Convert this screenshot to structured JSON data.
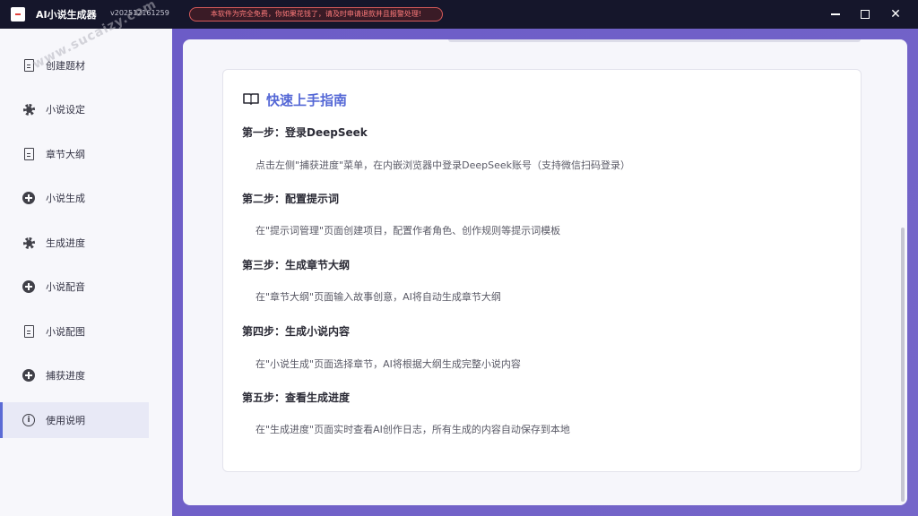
{
  "titlebar": {
    "app_title": "AI小说生成器",
    "version": "v202512161259",
    "warning": "本软件为完全免费，你如果花钱了，请及时申请退款并且报警处理!",
    "minimize_icon": "minimize-icon",
    "maximize_icon": "maximize-icon",
    "close_icon": "close-icon",
    "close_glyph": "✕"
  },
  "watermark": "www.sucaizy.com",
  "sidebar": {
    "items": [
      {
        "label": "创建题材",
        "icon": "document-icon"
      },
      {
        "label": "小说设定",
        "icon": "gear-icon"
      },
      {
        "label": "章节大纲",
        "icon": "document-icon"
      },
      {
        "label": "小说生成",
        "icon": "plus-circle-icon"
      },
      {
        "label": "生成进度",
        "icon": "gear-icon"
      },
      {
        "label": "小说配音",
        "icon": "plus-circle-icon"
      },
      {
        "label": "小说配图",
        "icon": "document-icon"
      },
      {
        "label": "捕获进度",
        "icon": "plus-circle-icon"
      },
      {
        "label": "使用说明",
        "icon": "info-icon"
      }
    ],
    "active_index": 8,
    "info_glyph": "i"
  },
  "guide": {
    "title": "快速上手指南",
    "icon": "book-icon",
    "steps": [
      {
        "title": "第一步：登录DeepSeek",
        "desc": "点击左侧\"捕获进度\"菜单，在内嵌浏览器中登录DeepSeek账号（支持微信扫码登录）"
      },
      {
        "title": "第二步：配置提示词",
        "desc": "在\"提示词管理\"页面创建项目，配置作者角色、创作规则等提示词模板"
      },
      {
        "title": "第三步：生成章节大纲",
        "desc": "在\"章节大纲\"页面输入故事创意，AI将自动生成章节大纲"
      },
      {
        "title": "第四步：生成小说内容",
        "desc": "在\"小说生成\"页面选择章节，AI将根据大纲生成完整小说内容"
      },
      {
        "title": "第五步：查看生成进度",
        "desc": "在\"生成进度\"页面实时查看AI创作日志，所有生成的内容自动保存到本地"
      }
    ]
  },
  "colors": {
    "accent": "#5568d6",
    "titlebar_bg": "#15162b",
    "main_bg": "#6c5cc7",
    "warning": "#ff7b7b"
  }
}
